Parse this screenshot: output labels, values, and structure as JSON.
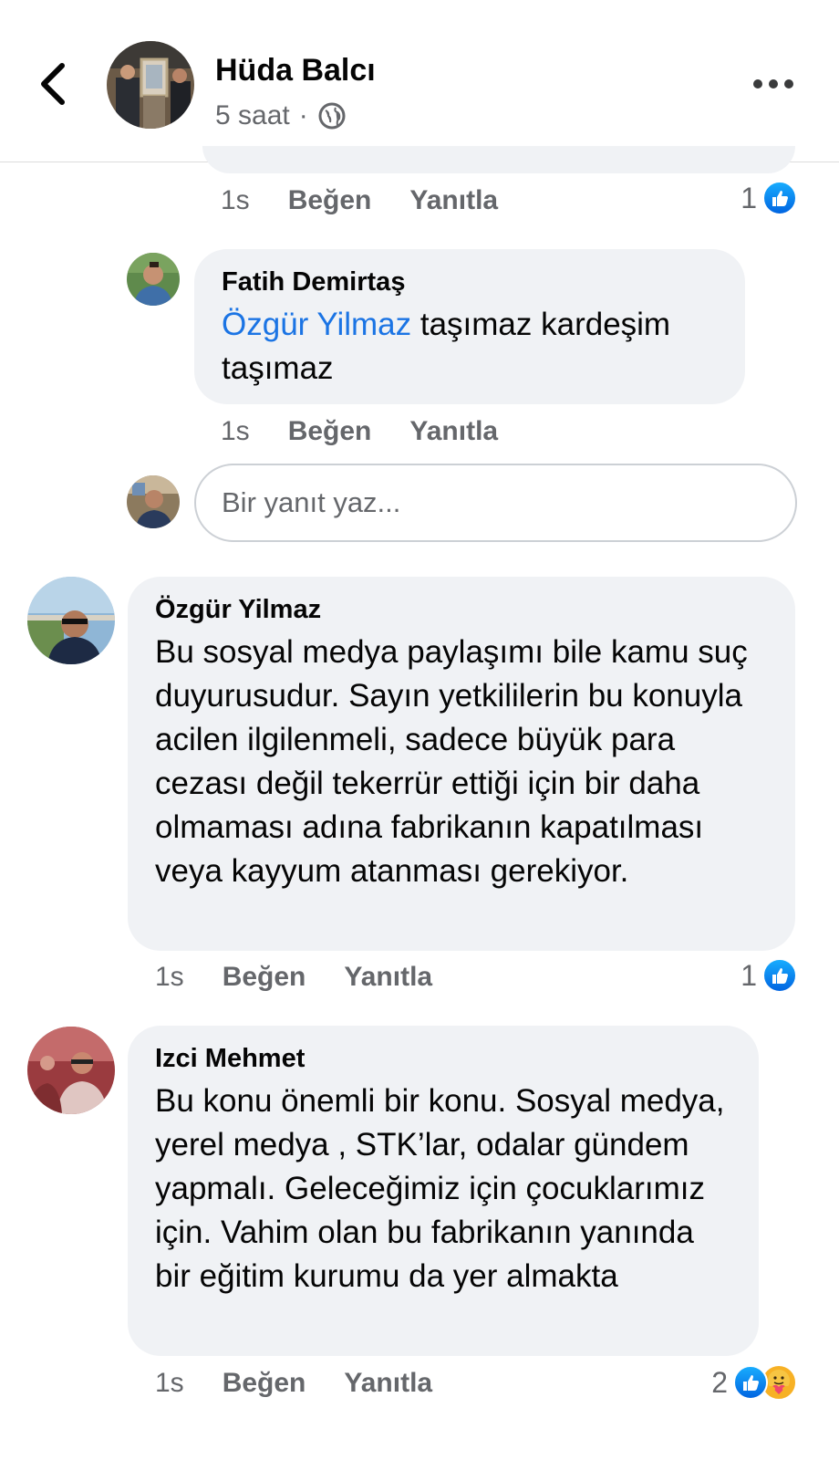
{
  "header": {
    "name": "Hüda Balcı",
    "time": "5 saat",
    "separator": "·",
    "privacy_icon": "globe-icon"
  },
  "comments": [
    {
      "time": "1s",
      "like_label": "Beğen",
      "reply_label": "Yanıtla",
      "reaction_count": "1"
    },
    {
      "author": "Fatih Demirtaş",
      "mention": "Özgür Yilmaz",
      "text": " taşımaz kardeşim taşımaz",
      "time": "1s",
      "like_label": "Beğen",
      "reply_label": "Yanıtla"
    },
    {
      "author": "Özgür Yilmaz",
      "text": "Bu sosyal medya paylaşımı bile kamu suç duyurusudur. Sayın yetkililerin bu konuyla acilen ilgilenmeli, sadece büyük para cezası değil tekerrür ettiği için bir daha olmaması adına fabrikanın kapatılması veya kayyum atanması gerekiyor.",
      "time": "1s",
      "like_label": "Beğen",
      "reply_label": "Yanıtla",
      "reaction_count": "1"
    },
    {
      "author": "Izci Mehmet",
      "text": "Bu konu önemli bir konu. Sosyal medya, yerel medya , STK’lar, odalar gündem yapmalı. Geleceğimiz için çocuklarımız için. Vahim olan bu fabrikanın yanında bir eğitim kurumu da yer almakta",
      "time": "1s",
      "like_label": "Beğen",
      "reply_label": "Yanıtla",
      "reaction_count": "2"
    }
  ],
  "reply_box": {
    "placeholder": "Bir yanıt yaz..."
  },
  "colors": {
    "bubble_bg": "#f0f2f5",
    "mention": "#1b74e4",
    "secondary_text": "#65676b",
    "like_blue": "#0165e1"
  }
}
